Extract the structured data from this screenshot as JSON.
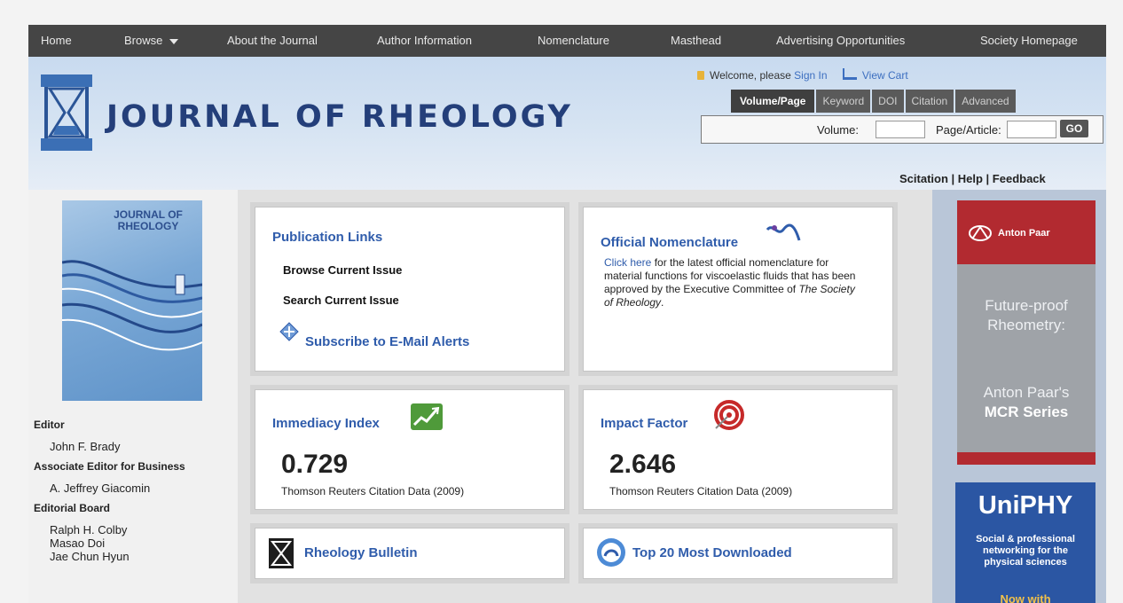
{
  "nav": {
    "items": [
      "Home",
      "Browse",
      "About the Journal",
      "Author Information",
      "Nomenclature",
      "Masthead",
      "Advertising Opportunities",
      "Society Homepage"
    ]
  },
  "header": {
    "title": "JOURNAL OF RHEOLOGY",
    "welcome": "Welcome, please",
    "sign_in": "Sign In",
    "view_cart": "View Cart",
    "utility_links": "Scitation | Help | Feedback"
  },
  "search": {
    "tabs": [
      "Volume/Page",
      "Keyword",
      "DOI",
      "Citation",
      "Advanced"
    ],
    "active_tab": "Volume/Page",
    "volume_label": "Volume:",
    "page_label": "Page/Article:",
    "go_label": "GO"
  },
  "cover": {
    "title_line1": "JOURNAL OF",
    "title_line2": "RHEOLOGY"
  },
  "editorial": {
    "editor_heading": "Editor",
    "editor_name": "John F. Brady",
    "assoc_heading": "Associate Editor for Business",
    "assoc_name": "A. Jeffrey Giacomin",
    "board_heading": "Editorial Board",
    "board": [
      "Ralph H. Colby",
      "Masao Doi",
      "Jae Chun Hyun"
    ]
  },
  "panels": {
    "publication": {
      "title": "Publication Links",
      "browse": "Browse Current Issue",
      "search": "Search Current Issue",
      "subscribe": "Subscribe to E-Mail Alerts"
    },
    "nomenclature": {
      "title": "Official Nomenclature",
      "click_here": "Click here",
      "text1": " for the latest official nomenclature for material functions for viscoelastic fluids that has been approved by the Executive Committee of ",
      "society": "The Society of Rheology",
      "text2": "."
    },
    "immediacy": {
      "title": "Immediacy Index",
      "value": "0.729",
      "source": "Thomson Reuters Citation Data (2009)"
    },
    "impact": {
      "title": "Impact Factor",
      "value": "2.646",
      "source": "Thomson Reuters Citation Data (2009)"
    },
    "bulletin": {
      "title": "Rheology Bulletin"
    },
    "top20": {
      "title": "Top 20 Most Downloaded"
    }
  },
  "ads": {
    "anton": {
      "brand": "Anton Paar",
      "line1": "Future-proof",
      "line2": "Rheometry:",
      "line3": "Anton Paar's",
      "line4": "MCR Series"
    },
    "uniphy": {
      "title": "UniPHY",
      "line1": "Social & professional",
      "line2": "networking for the",
      "line3": "physical sciences",
      "line4": "Now with"
    }
  },
  "colors": {
    "nav_bg": "#454545",
    "title_blue": "#243f7a",
    "link_blue": "#2f5cab",
    "anton_red": "#b22a30",
    "uniphy_blue": "#2b56a3"
  }
}
